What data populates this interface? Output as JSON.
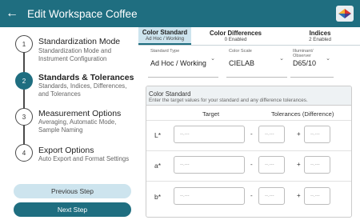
{
  "header": {
    "title": "Edit Workspace Coffee",
    "back_icon": "←",
    "logo_icon": "brand-logo-icon"
  },
  "colors": {
    "accent": "#1f6e80",
    "accent_light": "#cde4ee"
  },
  "sidebar": {
    "steps": [
      {
        "number": "1",
        "title": "Standardization Mode",
        "subtitle": "Standardization Mode and Instrument Configuration"
      },
      {
        "number": "2",
        "title": "Standards & Tolerances",
        "subtitle": "Standards, Indices, Differences, and Tolerances"
      },
      {
        "number": "3",
        "title": "Measurement Options",
        "subtitle": "Averaging, Automatic Mode, Sample Naming"
      },
      {
        "number": "4",
        "title": "Export Options",
        "subtitle": "Auto Export and Format Settings"
      }
    ],
    "previous_label": "Previous Step",
    "next_label": "Next Step"
  },
  "tabs": [
    {
      "label": "Color Standard",
      "sub": "Ad Hoc / Working"
    },
    {
      "label": "Color Differences",
      "sub": "0 Enabled"
    },
    {
      "label": "Indices",
      "sub": "2 Enabled"
    }
  ],
  "selects": [
    {
      "caption": "Standard Type",
      "value": "Ad Hoc / Working"
    },
    {
      "caption": "Color Scale",
      "value": "CIELAB"
    },
    {
      "caption": "Illuminant/ Observer",
      "value": "D65/10"
    }
  ],
  "card": {
    "title": "Color Standard",
    "subtitle": "Enter the target values for your standard and any difference tolerances.",
    "col_target": "Target",
    "col_tolerance": "Tolerances (Difference)",
    "minus": "-",
    "plus": "+",
    "placeholder": "--.---",
    "rows": [
      {
        "label": "L*"
      },
      {
        "label": "a*"
      },
      {
        "label": "b*"
      }
    ]
  }
}
